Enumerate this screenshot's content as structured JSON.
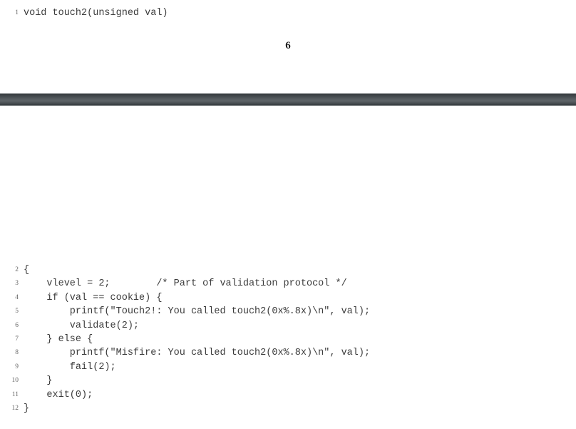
{
  "document": {
    "page_number": "6"
  },
  "top_listing": {
    "name": "code-fragment-top",
    "lines": [
      {
        "number": "1",
        "code": "void touch2(unsigned val)"
      }
    ]
  },
  "divider": {
    "name": "dark-horizontal-bar",
    "color_top": "#2f3438",
    "color_mid": "#5e6468",
    "color_bottom": "#5b6165"
  },
  "main_listing": {
    "name": "code-fragment-main",
    "lines": [
      {
        "number": "2",
        "code": "{"
      },
      {
        "number": "3",
        "code": "    vlevel = 2;        /* Part of validation protocol */"
      },
      {
        "number": "4",
        "code": "    if (val == cookie) {"
      },
      {
        "number": "5",
        "code": "        printf(\"Touch2!: You called touch2(0x%.8x)\\n\", val);"
      },
      {
        "number": "6",
        "code": "        validate(2);"
      },
      {
        "number": "7",
        "code": "    } else {"
      },
      {
        "number": "8",
        "code": "        printf(\"Misfire: You called touch2(0x%.8x)\\n\", val);"
      },
      {
        "number": "9",
        "code": "        fail(2);"
      },
      {
        "number": "10",
        "code": "    }"
      },
      {
        "number": "11",
        "code": "    exit(0);"
      },
      {
        "number": "12",
        "code": "}"
      }
    ]
  }
}
